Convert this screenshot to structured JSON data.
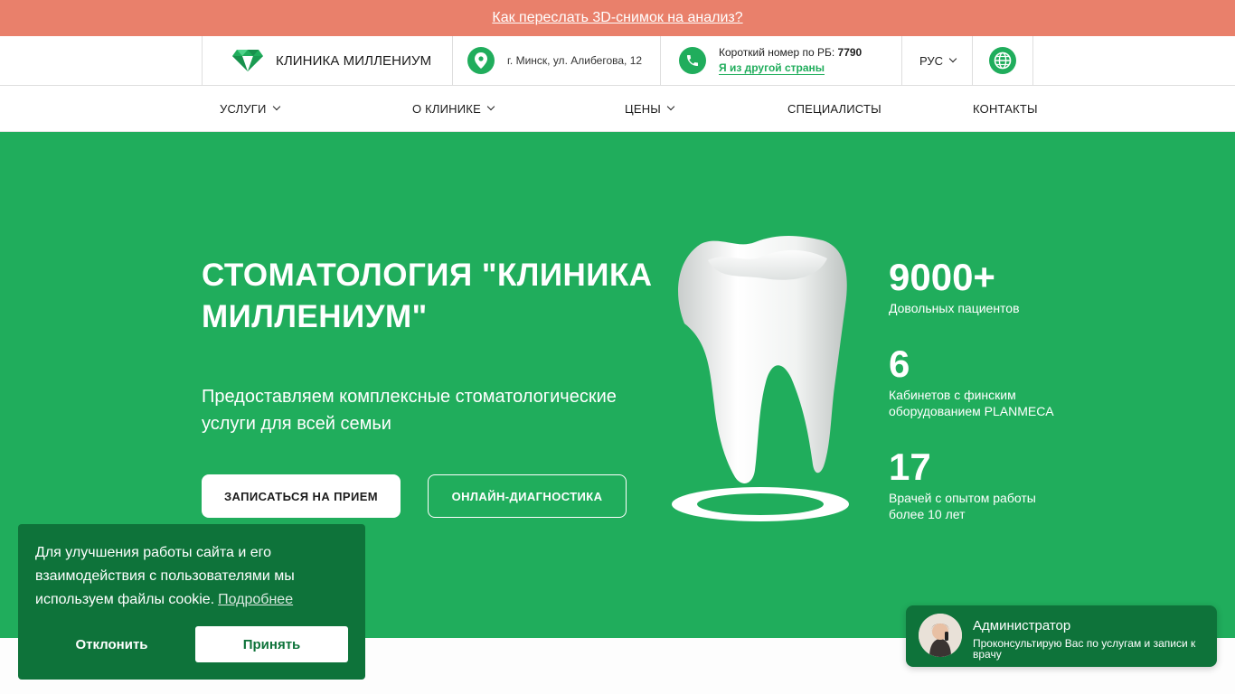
{
  "promo": {
    "link": "Как переслать 3D-снимок на анализ?"
  },
  "header": {
    "logo_text": "КЛИНИКА МИЛЛЕНИУМ",
    "address": "г. Минск, ул. Алибегова, 12",
    "phone_label": "Короткий номер по РБ:",
    "phone_number": "7790",
    "other_country_link": "Я из другой страны",
    "language": "РУС"
  },
  "nav": {
    "items": [
      {
        "label": "УСЛУГИ",
        "has_dropdown": true
      },
      {
        "label": "О КЛИНИКЕ",
        "has_dropdown": true
      },
      {
        "label": "ЦЕНЫ",
        "has_dropdown": true
      },
      {
        "label": "СПЕЦИАЛИСТЫ",
        "has_dropdown": false
      },
      {
        "label": "КОНТАКТЫ",
        "has_dropdown": false
      }
    ]
  },
  "hero": {
    "title": "СТОМАТОЛОГИЯ \"КЛИНИКА МИЛЛЕНИУМ\"",
    "subtitle": "Предоставляем комплексные стоматологические услуги для всей семьи",
    "primary_button": "ЗАПИСАТЬСЯ НА ПРИЕМ",
    "secondary_button": "ОНЛАЙН-ДИАГНОСТИКА",
    "stats": [
      {
        "value": "9000+",
        "label": "Довольных пациентов"
      },
      {
        "value": "6",
        "label": "Кабинетов с финским оборудованием PLANMECA"
      },
      {
        "value": "17",
        "label": "Врачей с опытом работы более 10 лет"
      }
    ]
  },
  "cookie": {
    "text": "Для улучшения работы сайта и его взаимодействия с пользователями мы используем файлы cookie.",
    "link": "Подробнее",
    "decline": "Отклонить",
    "accept": "Принять"
  },
  "chat": {
    "name": "Администратор",
    "description": "Проконсультирую Вас по услугам и записи к врачу"
  },
  "colors": {
    "brand_green": "#20ad5c",
    "dark_green": "#0e733a",
    "promo_bg": "#e9806b"
  },
  "icons": [
    "diamond-logo-icon",
    "location-pin-icon",
    "phone-icon",
    "chevron-down-icon",
    "globe-icon"
  ]
}
